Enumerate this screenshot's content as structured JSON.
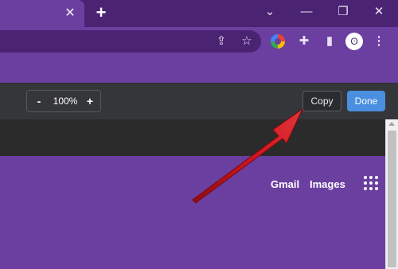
{
  "titlebar": {
    "tab_close_glyph": "✕",
    "new_tab_glyph": "+",
    "chevron_glyph": "⌄",
    "minimize_glyph": "—",
    "restore_glyph": "❐",
    "close_glyph": "✕"
  },
  "toolbar": {
    "share_glyph": "⇪",
    "star_glyph": "☆",
    "puzzle_glyph": "✚",
    "sidepanel_glyph": "▮",
    "avatar_glyph": "ʘ",
    "menu_glyph": "⋮"
  },
  "devtools": {
    "zoom_minus": "-",
    "zoom_value": "100%",
    "zoom_plus": "+",
    "copy_label": "Copy",
    "done_label": "Done"
  },
  "page": {
    "gmail_label": "Gmail",
    "images_label": "Images"
  },
  "colors": {
    "titlebar": "#4a2473",
    "page_purple": "#6b3fa0",
    "devbar": "#35363a",
    "done_blue": "#4a8fe0",
    "arrow_red": "#c8141c"
  }
}
